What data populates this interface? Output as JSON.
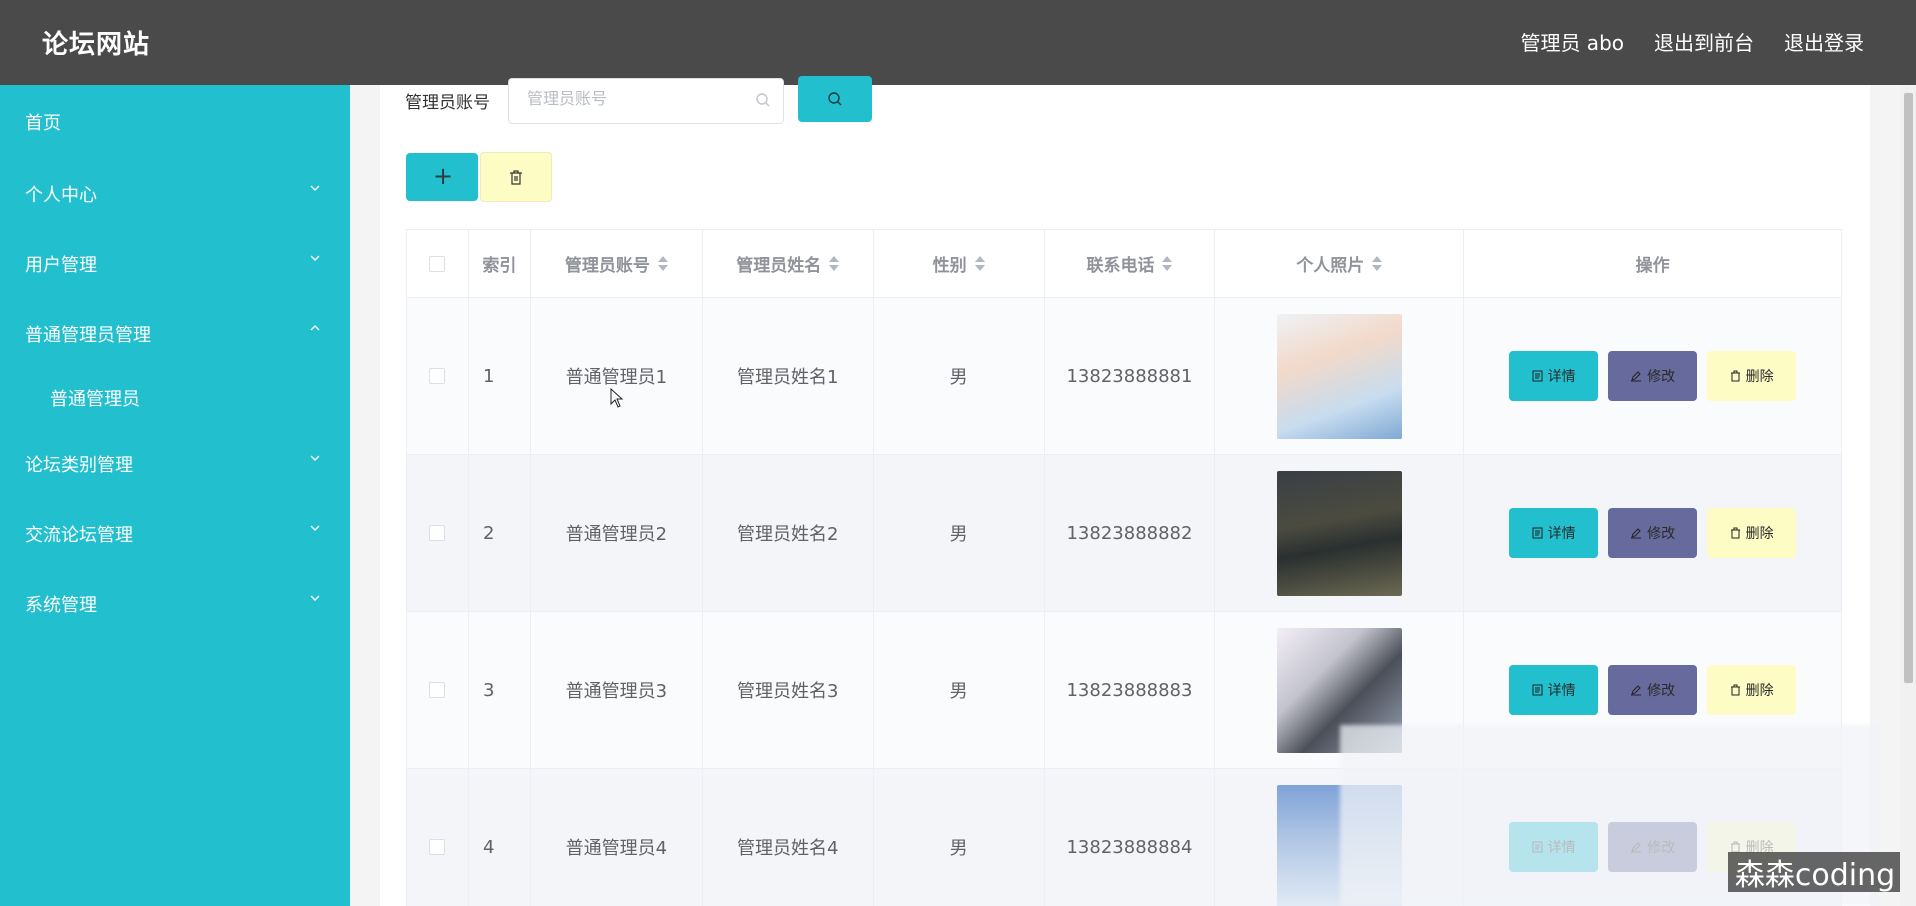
{
  "header": {
    "brand": "论坛网站",
    "admin_label": "管理员 abo",
    "back_to_front": "退出到前台",
    "logout": "退出登录"
  },
  "sidebar": {
    "items": [
      {
        "label": "首页",
        "expandable": false,
        "expanded": false
      },
      {
        "label": "个人中心",
        "expandable": true,
        "expanded": false
      },
      {
        "label": "用户管理",
        "expandable": true,
        "expanded": false
      },
      {
        "label": "普通管理员管理",
        "expandable": true,
        "expanded": true
      },
      {
        "label": "普通管理员",
        "sub": true
      },
      {
        "label": "论坛类别管理",
        "expandable": true,
        "expanded": false
      },
      {
        "label": "交流论坛管理",
        "expandable": true,
        "expanded": false
      },
      {
        "label": "系统管理",
        "expandable": true,
        "expanded": false
      }
    ]
  },
  "search": {
    "label": "管理员账号",
    "placeholder": "管理员账号",
    "value": ""
  },
  "toolbar": {
    "add_label": "+"
  },
  "table": {
    "headers": [
      "索引",
      "管理员账号",
      "管理员姓名",
      "性别",
      "联系电话",
      "个人照片",
      "操作"
    ],
    "rows": [
      {
        "index": "1",
        "account": "普通管理员1",
        "name": "管理员姓名1",
        "gender": "男",
        "phone": "13823888881"
      },
      {
        "index": "2",
        "account": "普通管理员2",
        "name": "管理员姓名2",
        "gender": "男",
        "phone": "13823888882"
      },
      {
        "index": "3",
        "account": "普通管理员3",
        "name": "管理员姓名3",
        "gender": "男",
        "phone": "13823888883"
      },
      {
        "index": "4",
        "account": "普通管理员4",
        "name": "管理员姓名4",
        "gender": "男",
        "phone": "13823888884"
      }
    ],
    "actions": {
      "detail": "详情",
      "edit": "修改",
      "delete": "删除"
    }
  },
  "watermark": "森森coding",
  "colors": {
    "topbar": "#4a4a4a",
    "sidebar": "#22bfcf",
    "detail_button": "#22bfcf",
    "edit_button": "#676a9c",
    "delete_button": "#fdfcc4"
  }
}
